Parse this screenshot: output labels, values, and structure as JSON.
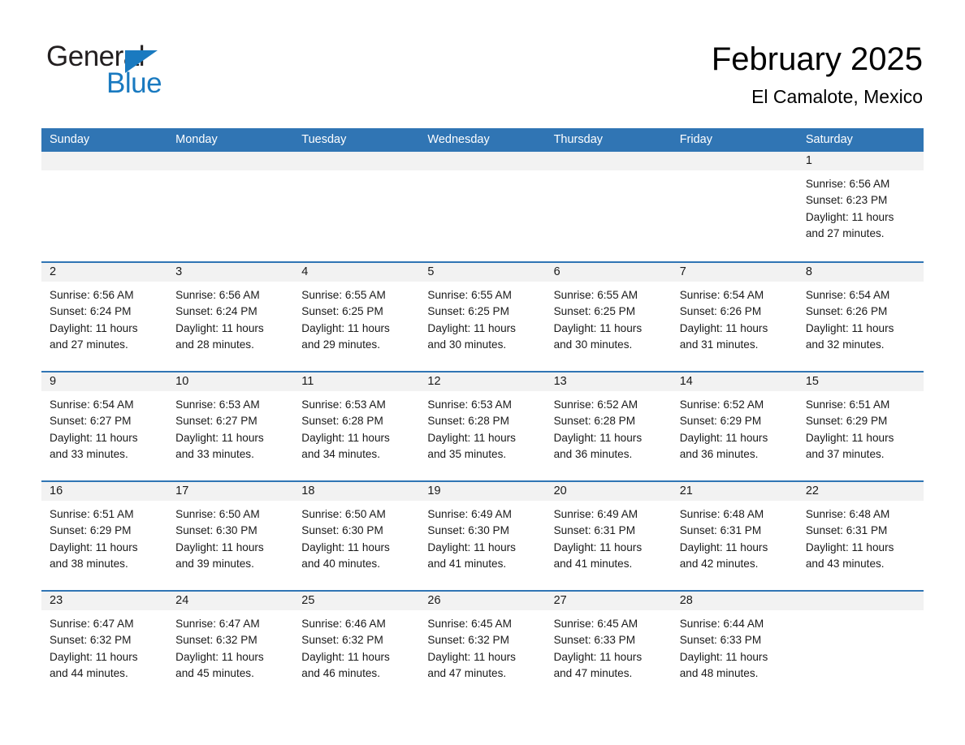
{
  "logo": {
    "word_general": "General",
    "word_blue": "Blue",
    "triangle_icon": "triangle-icon",
    "accent_color": "#1a7ac0"
  },
  "header": {
    "title": "February 2025",
    "subtitle": "El Camalote, Mexico"
  },
  "calendar": {
    "header_bg": "#3075b4",
    "daynum_band_bg": "#f2f2f2",
    "weekdays": [
      "Sunday",
      "Monday",
      "Tuesday",
      "Wednesday",
      "Thursday",
      "Friday",
      "Saturday"
    ],
    "weeks": [
      [
        {
          "empty": true
        },
        {
          "empty": true
        },
        {
          "empty": true
        },
        {
          "empty": true
        },
        {
          "empty": true
        },
        {
          "empty": true
        },
        {
          "day": "1",
          "sunrise": "Sunrise: 6:56 AM",
          "sunset": "Sunset: 6:23 PM",
          "daylight_1": "Daylight: 11 hours",
          "daylight_2": "and 27 minutes."
        }
      ],
      [
        {
          "day": "2",
          "sunrise": "Sunrise: 6:56 AM",
          "sunset": "Sunset: 6:24 PM",
          "daylight_1": "Daylight: 11 hours",
          "daylight_2": "and 27 minutes."
        },
        {
          "day": "3",
          "sunrise": "Sunrise: 6:56 AM",
          "sunset": "Sunset: 6:24 PM",
          "daylight_1": "Daylight: 11 hours",
          "daylight_2": "and 28 minutes."
        },
        {
          "day": "4",
          "sunrise": "Sunrise: 6:55 AM",
          "sunset": "Sunset: 6:25 PM",
          "daylight_1": "Daylight: 11 hours",
          "daylight_2": "and 29 minutes."
        },
        {
          "day": "5",
          "sunrise": "Sunrise: 6:55 AM",
          "sunset": "Sunset: 6:25 PM",
          "daylight_1": "Daylight: 11 hours",
          "daylight_2": "and 30 minutes."
        },
        {
          "day": "6",
          "sunrise": "Sunrise: 6:55 AM",
          "sunset": "Sunset: 6:25 PM",
          "daylight_1": "Daylight: 11 hours",
          "daylight_2": "and 30 minutes."
        },
        {
          "day": "7",
          "sunrise": "Sunrise: 6:54 AM",
          "sunset": "Sunset: 6:26 PM",
          "daylight_1": "Daylight: 11 hours",
          "daylight_2": "and 31 minutes."
        },
        {
          "day": "8",
          "sunrise": "Sunrise: 6:54 AM",
          "sunset": "Sunset: 6:26 PM",
          "daylight_1": "Daylight: 11 hours",
          "daylight_2": "and 32 minutes."
        }
      ],
      [
        {
          "day": "9",
          "sunrise": "Sunrise: 6:54 AM",
          "sunset": "Sunset: 6:27 PM",
          "daylight_1": "Daylight: 11 hours",
          "daylight_2": "and 33 minutes."
        },
        {
          "day": "10",
          "sunrise": "Sunrise: 6:53 AM",
          "sunset": "Sunset: 6:27 PM",
          "daylight_1": "Daylight: 11 hours",
          "daylight_2": "and 33 minutes."
        },
        {
          "day": "11",
          "sunrise": "Sunrise: 6:53 AM",
          "sunset": "Sunset: 6:28 PM",
          "daylight_1": "Daylight: 11 hours",
          "daylight_2": "and 34 minutes."
        },
        {
          "day": "12",
          "sunrise": "Sunrise: 6:53 AM",
          "sunset": "Sunset: 6:28 PM",
          "daylight_1": "Daylight: 11 hours",
          "daylight_2": "and 35 minutes."
        },
        {
          "day": "13",
          "sunrise": "Sunrise: 6:52 AM",
          "sunset": "Sunset: 6:28 PM",
          "daylight_1": "Daylight: 11 hours",
          "daylight_2": "and 36 minutes."
        },
        {
          "day": "14",
          "sunrise": "Sunrise: 6:52 AM",
          "sunset": "Sunset: 6:29 PM",
          "daylight_1": "Daylight: 11 hours",
          "daylight_2": "and 36 minutes."
        },
        {
          "day": "15",
          "sunrise": "Sunrise: 6:51 AM",
          "sunset": "Sunset: 6:29 PM",
          "daylight_1": "Daylight: 11 hours",
          "daylight_2": "and 37 minutes."
        }
      ],
      [
        {
          "day": "16",
          "sunrise": "Sunrise: 6:51 AM",
          "sunset": "Sunset: 6:29 PM",
          "daylight_1": "Daylight: 11 hours",
          "daylight_2": "and 38 minutes."
        },
        {
          "day": "17",
          "sunrise": "Sunrise: 6:50 AM",
          "sunset": "Sunset: 6:30 PM",
          "daylight_1": "Daylight: 11 hours",
          "daylight_2": "and 39 minutes."
        },
        {
          "day": "18",
          "sunrise": "Sunrise: 6:50 AM",
          "sunset": "Sunset: 6:30 PM",
          "daylight_1": "Daylight: 11 hours",
          "daylight_2": "and 40 minutes."
        },
        {
          "day": "19",
          "sunrise": "Sunrise: 6:49 AM",
          "sunset": "Sunset: 6:30 PM",
          "daylight_1": "Daylight: 11 hours",
          "daylight_2": "and 41 minutes."
        },
        {
          "day": "20",
          "sunrise": "Sunrise: 6:49 AM",
          "sunset": "Sunset: 6:31 PM",
          "daylight_1": "Daylight: 11 hours",
          "daylight_2": "and 41 minutes."
        },
        {
          "day": "21",
          "sunrise": "Sunrise: 6:48 AM",
          "sunset": "Sunset: 6:31 PM",
          "daylight_1": "Daylight: 11 hours",
          "daylight_2": "and 42 minutes."
        },
        {
          "day": "22",
          "sunrise": "Sunrise: 6:48 AM",
          "sunset": "Sunset: 6:31 PM",
          "daylight_1": "Daylight: 11 hours",
          "daylight_2": "and 43 minutes."
        }
      ],
      [
        {
          "day": "23",
          "sunrise": "Sunrise: 6:47 AM",
          "sunset": "Sunset: 6:32 PM",
          "daylight_1": "Daylight: 11 hours",
          "daylight_2": "and 44 minutes."
        },
        {
          "day": "24",
          "sunrise": "Sunrise: 6:47 AM",
          "sunset": "Sunset: 6:32 PM",
          "daylight_1": "Daylight: 11 hours",
          "daylight_2": "and 45 minutes."
        },
        {
          "day": "25",
          "sunrise": "Sunrise: 6:46 AM",
          "sunset": "Sunset: 6:32 PM",
          "daylight_1": "Daylight: 11 hours",
          "daylight_2": "and 46 minutes."
        },
        {
          "day": "26",
          "sunrise": "Sunrise: 6:45 AM",
          "sunset": "Sunset: 6:32 PM",
          "daylight_1": "Daylight: 11 hours",
          "daylight_2": "and 47 minutes."
        },
        {
          "day": "27",
          "sunrise": "Sunrise: 6:45 AM",
          "sunset": "Sunset: 6:33 PM",
          "daylight_1": "Daylight: 11 hours",
          "daylight_2": "and 47 minutes."
        },
        {
          "day": "28",
          "sunrise": "Sunrise: 6:44 AM",
          "sunset": "Sunset: 6:33 PM",
          "daylight_1": "Daylight: 11 hours",
          "daylight_2": "and 48 minutes."
        },
        {
          "empty": true
        }
      ]
    ]
  }
}
